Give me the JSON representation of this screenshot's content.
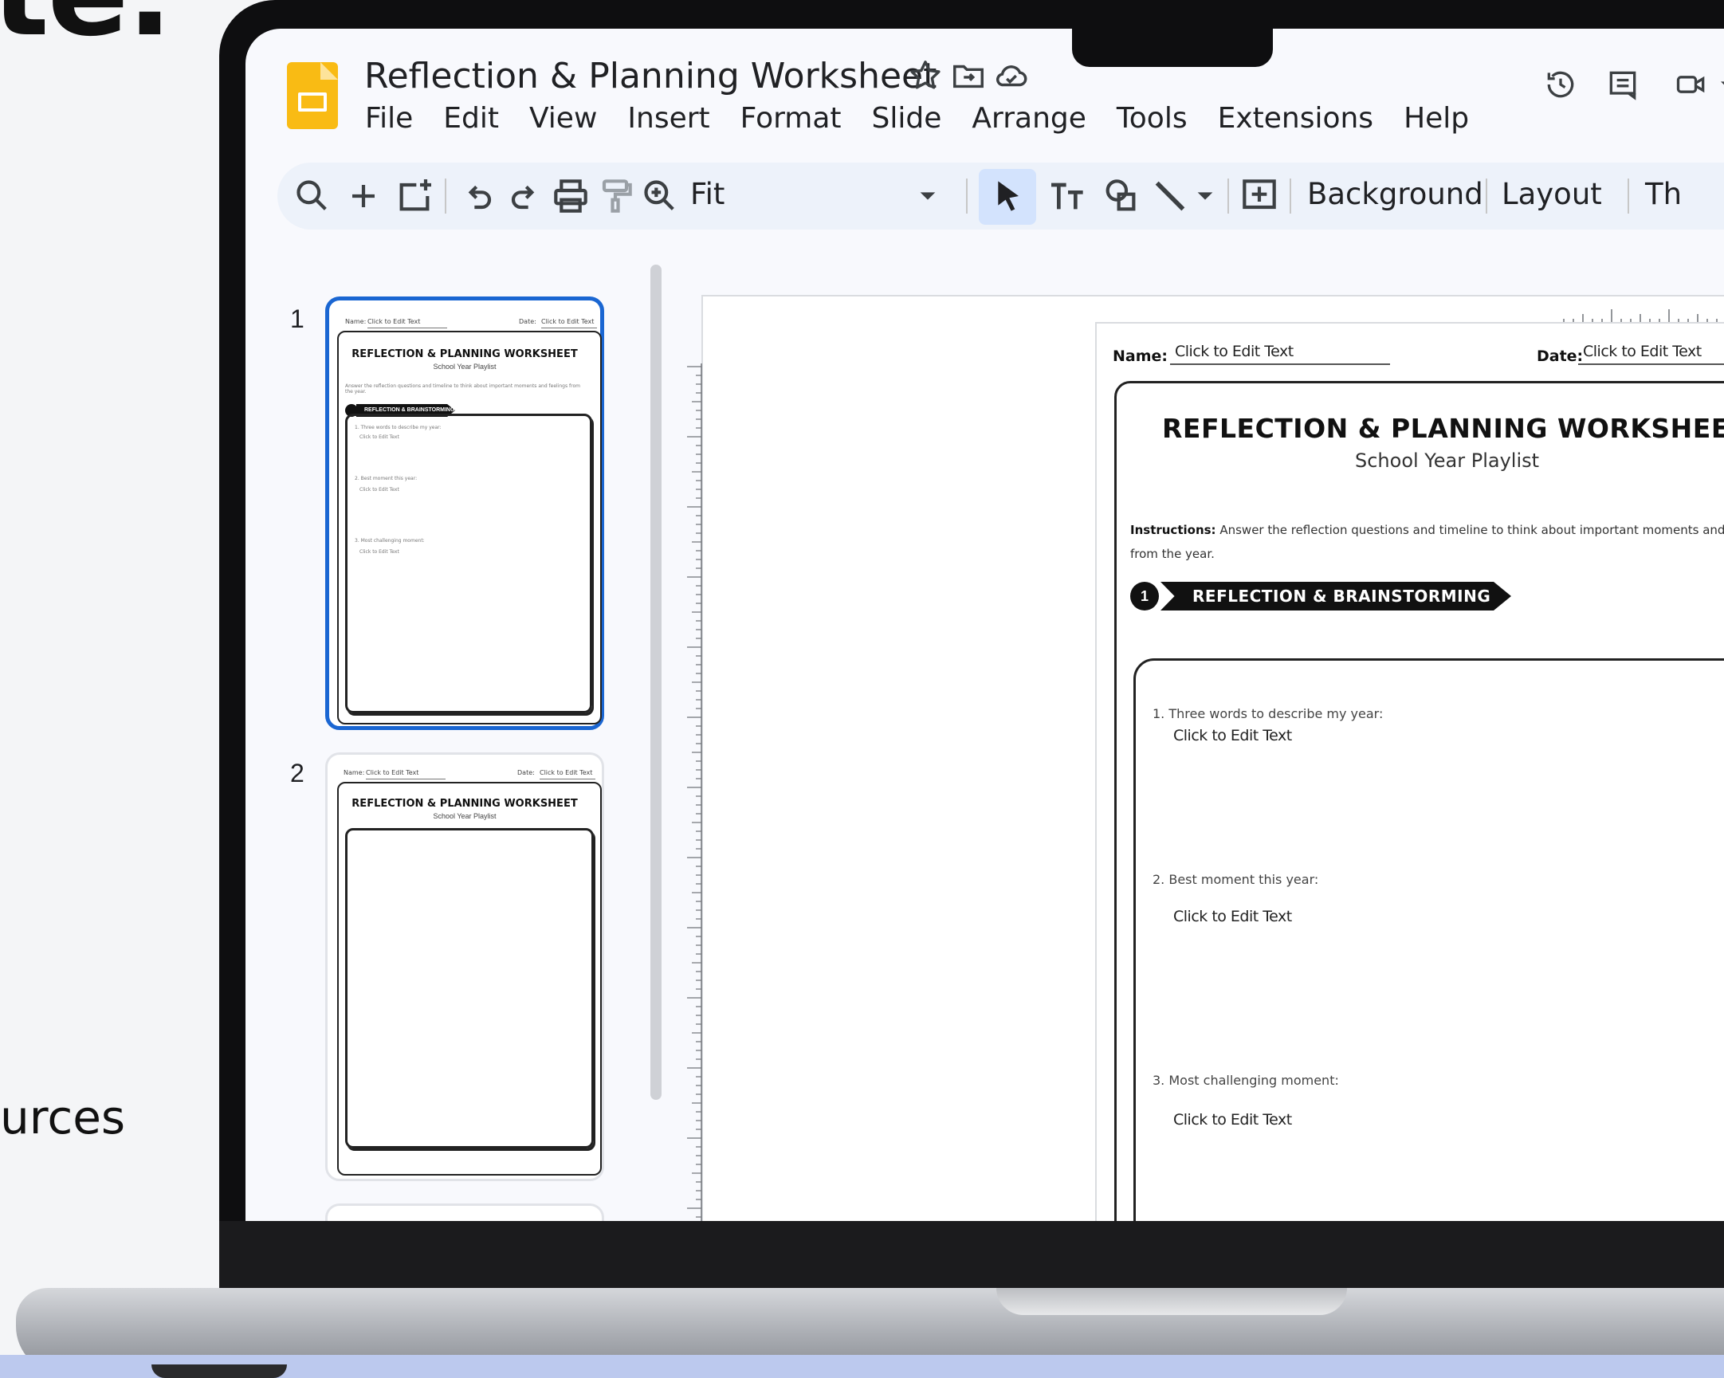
{
  "background_text": {
    "top": "te.",
    "bottom": "urces"
  },
  "app": {
    "title": "Reflection & Planning Worksheet",
    "menu": [
      "File",
      "Edit",
      "View",
      "Insert",
      "Format",
      "Slide",
      "Arrange",
      "Tools",
      "Extensions",
      "Help"
    ]
  },
  "toolbar": {
    "zoom_label": "Fit",
    "background_label": "Background",
    "layout_label": "Layout",
    "theme_label_partial": "Th"
  },
  "filmstrip": {
    "slides": [
      {
        "number": "1",
        "selected": true
      },
      {
        "number": "2",
        "selected": false
      }
    ]
  },
  "slide": {
    "name_label": "Name:",
    "name_value": "Click to Edit Text",
    "date_label": "Date:",
    "date_value": "Click to Edit Text",
    "title": "REFLECTION & PLANNING WORKSHEET",
    "subtitle": "School Year Playlist",
    "instructions_label": "Instructions:",
    "instructions_text": "Answer the reflection questions and timeline to think about important moments and feelings from the year.",
    "section_number": "1",
    "section_title": "REFLECTION & BRAINSTORMING",
    "questions": [
      {
        "prompt": "1. Three words to describe my year:",
        "answer": "Click to Edit Text"
      },
      {
        "prompt": "2. Best moment this year:",
        "answer": "Click to Edit Text"
      },
      {
        "prompt": "3. Most challenging moment:",
        "answer": "Click to Edit Text"
      }
    ]
  },
  "colors": {
    "accent": "#1a66d2",
    "slides_logo": "#f9bb14",
    "toolbar_bg": "#edf2fa",
    "active_tool": "#d3e3fd"
  },
  "icons": {
    "title": [
      "star-icon",
      "move-to-folder-icon",
      "cloud-saved-icon"
    ],
    "header_right": [
      "version-history-icon",
      "comments-icon",
      "meet-icon"
    ],
    "toolbar": [
      "search-icon",
      "new-slide-icon",
      "new-slide-from-layout-icon",
      "undo-icon",
      "redo-icon",
      "print-icon",
      "paint-format-icon",
      "zoom-icon",
      "select-tool-icon",
      "text-box-icon",
      "shape-icon",
      "line-icon",
      "comment-add-icon"
    ]
  }
}
